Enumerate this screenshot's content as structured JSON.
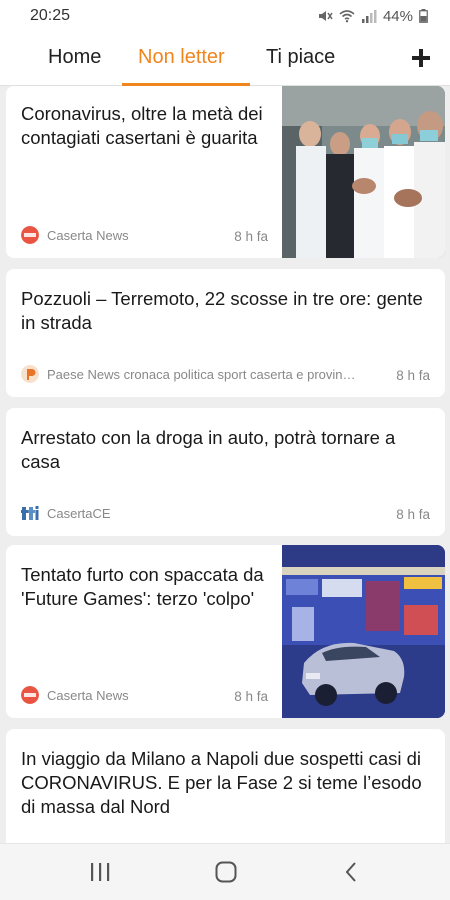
{
  "status_bar": {
    "time": "20:25",
    "battery": "44%",
    "icons": [
      "mute-icon",
      "wifi-icon",
      "signal-icon",
      "battery-icon"
    ]
  },
  "tabs": [
    {
      "label": "Home",
      "active": false
    },
    {
      "label": "Non letter",
      "active": true
    },
    {
      "label": "Ti piace",
      "active": false
    }
  ],
  "add_tab_icon": "plus-icon",
  "accent_color": "#f0851d",
  "articles": [
    {
      "title": "Coronavirus, oltre la metà dei contagiati casertani è guarita",
      "source": "Caserta News",
      "time": "8 h fa",
      "has_image": true,
      "image_subject": "healthcare workers applauding"
    },
    {
      "title": "Pozzuoli – Terremoto, 22 scosse in tre ore: gente in strada",
      "source": "Paese News cronaca politica sport caserta e provin…",
      "time": "8 h fa",
      "has_image": false
    },
    {
      "title": "Arrestato con la droga in auto, potrà tornare a casa",
      "source": "CasertaCE",
      "time": "8 h fa",
      "has_image": false
    },
    {
      "title": "Tentato furto con spaccata da 'Future Games': terzo 'colpo'",
      "source": "Caserta News",
      "time": "8 h fa",
      "has_image": true,
      "image_subject": "car crashed into shop front"
    },
    {
      "title": "In viaggio da Milano a Napoli due sospetti casi di CORONAVIRUS. E per la Fase 2 si teme l’esodo di massa dal Nord",
      "has_image": false
    }
  ],
  "nav_bar": {
    "icons": [
      "recent-apps-icon",
      "home-icon",
      "back-icon"
    ]
  }
}
